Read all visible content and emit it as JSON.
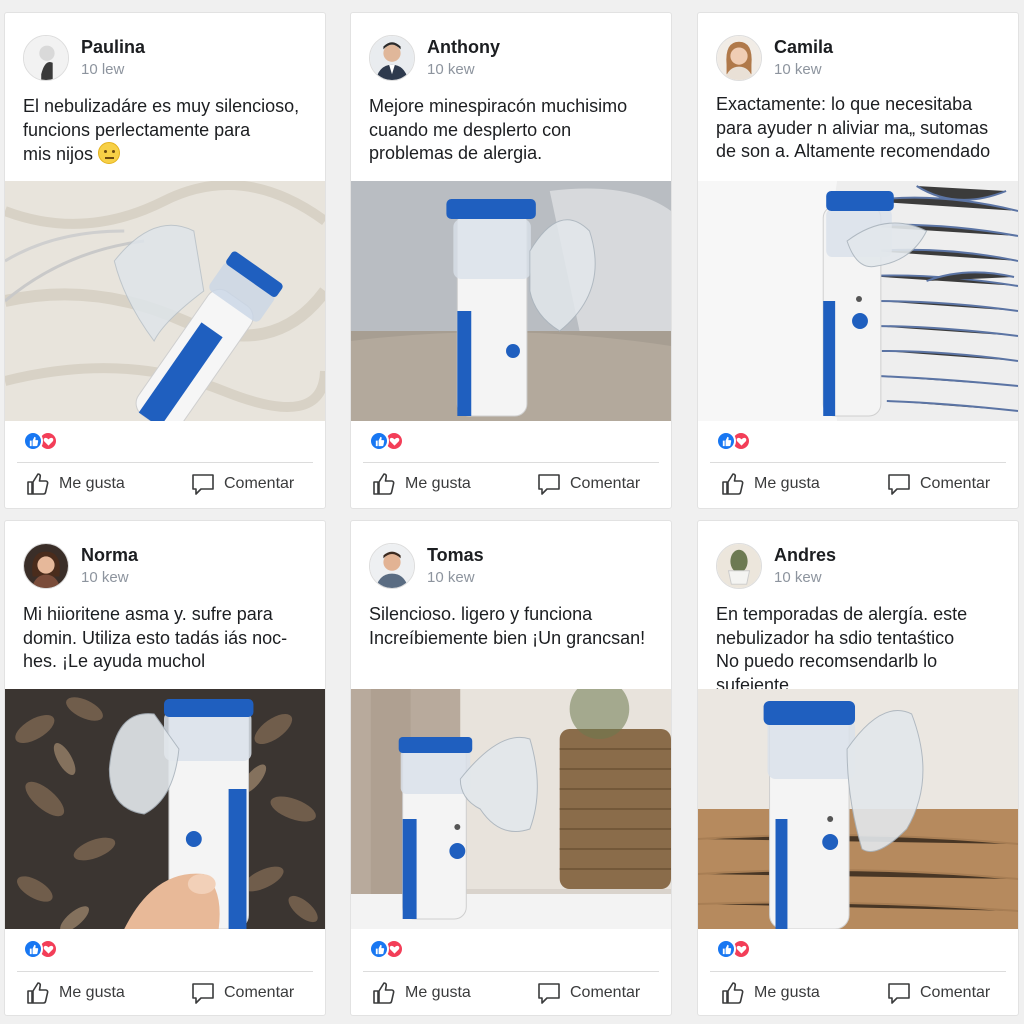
{
  "actions": {
    "like_label": "Me gusta",
    "comment_label": "Comentar"
  },
  "icons": {
    "like": "thumbs-up-icon",
    "comment": "speech-bubble-icon",
    "reaction_like": "like-reaction-icon",
    "reaction_love": "heart-reaction-icon"
  },
  "colors": {
    "like_blue": "#1877f2",
    "love_red": "#f33e58",
    "device_blue": "#1f5fbf",
    "card_bg": "#ffffff"
  },
  "posts": [
    {
      "author": "Paulina",
      "time": "10 lew",
      "text_lines": [
        "El nebulizadáre es muy silencioso,",
        "funcions perlectamente para",
        "mis nijos"
      ],
      "emoji": "neutral-face-emoji"
    },
    {
      "author": "Anthony",
      "time": "10 kew",
      "text_lines": [
        "Mejore  minespiracón  muchisimo",
        "cuando me desplerto con",
        "problemas de alergia."
      ]
    },
    {
      "author": "Camila",
      "time": "10 kew",
      "text_lines": [
        "Exactamente: lo que necesitaba",
        "para ayuder n aliviar ma„ sutomas",
        "de son a. Altamente recomendado"
      ]
    },
    {
      "author": "Norma",
      "time": "10 kew",
      "text_lines": [
        "Mi hiioritene asma y. sufre para",
        "domin. Utiliza esto tadás iás noc-",
        "hes. ¡Le ayuda muchol"
      ]
    },
    {
      "author": "Tomas",
      "time": "10 kew",
      "text_lines": [
        "Silencioso. ligero y funciona",
        "Increíbiemente bien  ¡Un grancsan!"
      ]
    },
    {
      "author": "Andres",
      "time": "10 kew",
      "text_lines": [
        "En  temporadas  de  alergía. este",
        "nebulizador ha sdio tentaśtico",
        "No puedo recomsendarlb lo sufeiente."
      ]
    }
  ]
}
